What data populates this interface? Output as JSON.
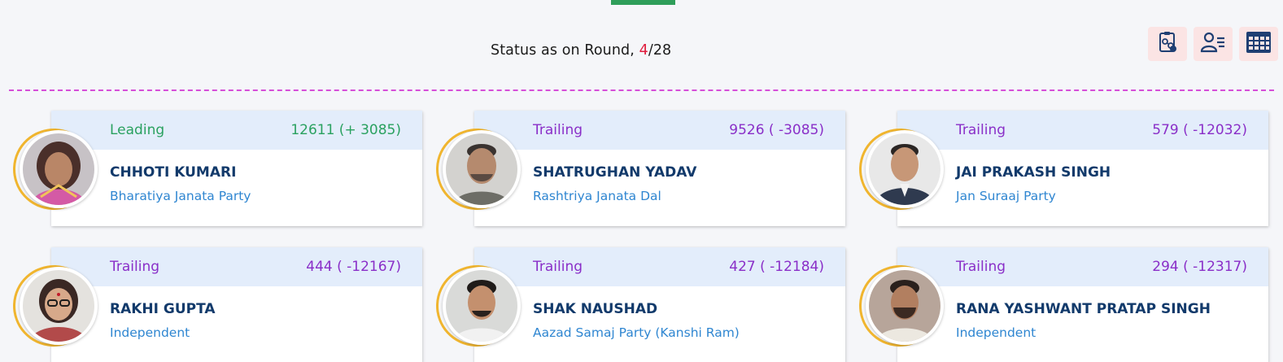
{
  "status": {
    "prefix": "Status as on Round, ",
    "current_round": "4",
    "separator": "/",
    "total_rounds": "28"
  },
  "tools": [
    {
      "icon": "report-icon"
    },
    {
      "icon": "candidate-list-icon"
    },
    {
      "icon": "table-grid-icon"
    }
  ],
  "colors": {
    "leading": "#2aa160",
    "trailing": "#8a2fc8",
    "name": "#123a6b",
    "party": "#2f86d1",
    "card_header": "#e3edfb",
    "accent_ring": "#f0b52f",
    "divider": "#d64fd8",
    "tab_indicator": "#2f9e5a",
    "round_highlight": "#e01b3c"
  },
  "candidates": [
    {
      "status": "Leading",
      "votes": "12611 (+ 3085)",
      "name": "CHHOTI KUMARI",
      "party": "Bharatiya Janata Party"
    },
    {
      "status": "Trailing",
      "votes": "9526 ( -3085)",
      "name": "SHATRUGHAN YADAV",
      "party": "Rashtriya Janata Dal"
    },
    {
      "status": "Trailing",
      "votes": "579 ( -12032)",
      "name": "JAI PRAKASH SINGH",
      "party": "Jan Suraaj Party"
    },
    {
      "status": "Trailing",
      "votes": "444 ( -12167)",
      "name": "RAKHI GUPTA",
      "party": "Independent"
    },
    {
      "status": "Trailing",
      "votes": "427 ( -12184)",
      "name": "SHAK NAUSHAD",
      "party": "Aazad Samaj Party (Kanshi Ram)"
    },
    {
      "status": "Trailing",
      "votes": "294 ( -12317)",
      "name": "RANA YASHWANT PRATAP SINGH",
      "party": "Independent"
    }
  ]
}
